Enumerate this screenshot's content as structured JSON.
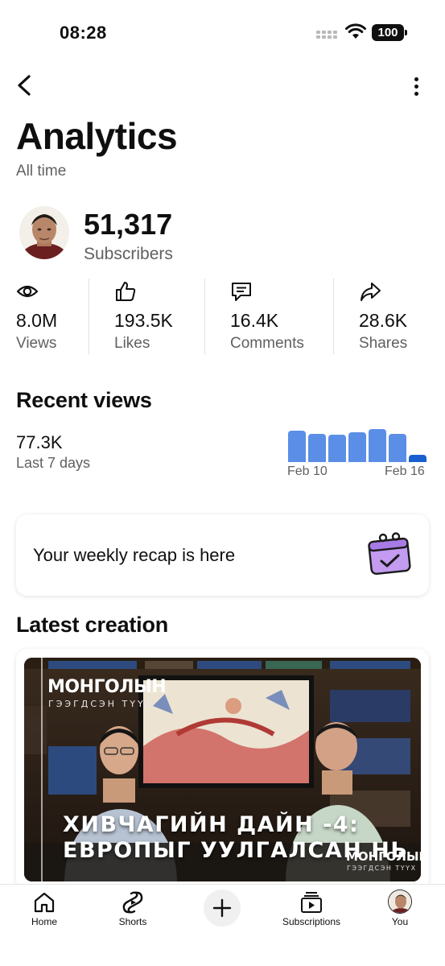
{
  "status_bar": {
    "time": "08:28",
    "battery": "100"
  },
  "header": {
    "title": "Analytics",
    "subtitle": "All time"
  },
  "channel": {
    "subscribers_value": "51,317",
    "subscribers_label": "Subscribers"
  },
  "stats": [
    {
      "icon": "eye-icon",
      "value": "8.0M",
      "label": "Views"
    },
    {
      "icon": "thumbs-up-icon",
      "value": "193.5K",
      "label": "Likes"
    },
    {
      "icon": "comment-icon",
      "value": "16.4K",
      "label": "Comments"
    },
    {
      "icon": "share-icon",
      "value": "28.6K",
      "label": "Shares"
    }
  ],
  "recent_views": {
    "title": "Recent views",
    "value": "77.3K",
    "period_label": "Last 7 days",
    "chart": {
      "start_label": "Feb 10",
      "end_label": "Feb 16",
      "relative_levels": [
        0.84,
        0.76,
        0.74,
        0.8,
        0.9,
        0.77,
        0.2
      ]
    }
  },
  "recap": {
    "text": "Your weekly recap is here"
  },
  "latest_creation": {
    "title": "Latest creation",
    "thumbnail": {
      "brand": "МОНГОЛЫН",
      "brand_sub": "ГЭЭГДСЭН ТҮҮХ",
      "line1": "ХИВЧАГИЙН ДАЙН -4:",
      "line2": "ЕВРОПЫГ УУЛГАЛСАН НЬ",
      "logo": "МОНГОЛЫН",
      "logo_sub": "ГЭЭГДСЭН ТҮҮХ"
    }
  },
  "tabbar": {
    "home": "Home",
    "shorts": "Shorts",
    "subscriptions": "Subscriptions",
    "you": "You"
  },
  "colors": {
    "bar": "#5b8ee6",
    "bar_current": "#1a5fd0",
    "secondary_text": "#606060"
  }
}
